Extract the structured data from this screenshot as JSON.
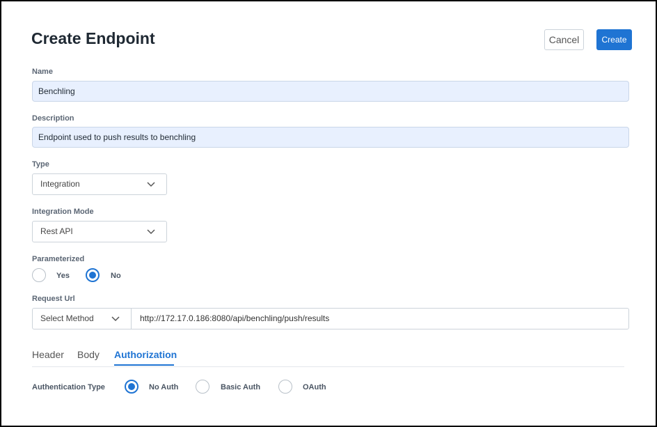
{
  "header": {
    "title": "Create Endpoint",
    "cancel_label": "Cancel",
    "create_label": "Create"
  },
  "form": {
    "name": {
      "label": "Name",
      "value": "Benchling"
    },
    "description": {
      "label": "Description",
      "value": "Endpoint used to push results to benchling"
    },
    "type": {
      "label": "Type",
      "value": "Integration"
    },
    "integration_mode": {
      "label": "Integration Mode",
      "value": "Rest API"
    },
    "parameterized": {
      "label": "Parameterized",
      "options": [
        "Yes",
        "No"
      ],
      "selected": "No"
    },
    "request_url": {
      "label": "Request Url",
      "method_placeholder": "Select Method",
      "value": "http://172.17.0.186:8080/api/benchling/push/results"
    }
  },
  "tabs": {
    "items": [
      "Header",
      "Body",
      "Authorization"
    ],
    "active": "Authorization"
  },
  "auth": {
    "label": "Authentication Type",
    "options": [
      "No Auth",
      "Basic Auth",
      "OAuth"
    ],
    "selected": "No Auth"
  },
  "colors": {
    "accent": "#1f74d3",
    "input_fill": "#e8f0fe"
  },
  "icons": {
    "select_arrow": "chevron-down-icon"
  }
}
